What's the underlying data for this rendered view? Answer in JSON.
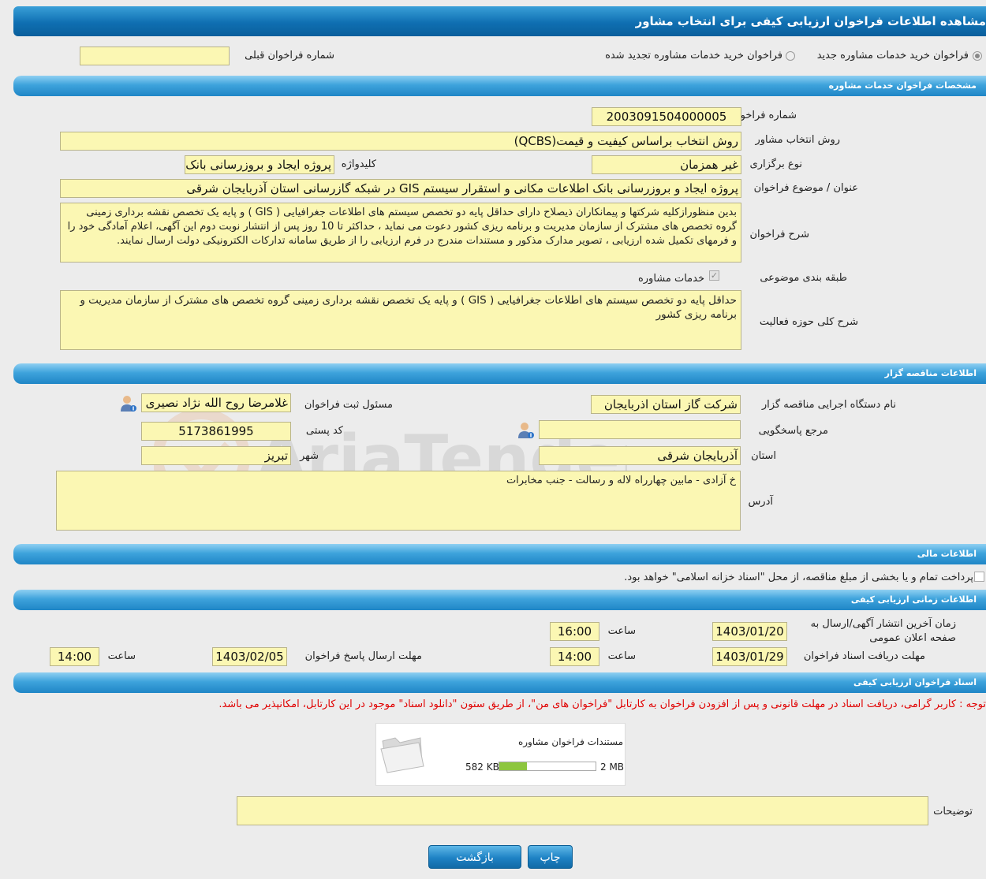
{
  "title": "مشاهده اطلاعات فراخوان ارزیابی کیفی برای انتخاب مشاور",
  "top": {
    "radio_new": "فراخوان خرید خدمات مشاوره جدید",
    "radio_renewed": "فراخوان خرید خدمات مشاوره تجدید شده",
    "prev_label": "شماره فراخوان قبلی",
    "prev_value": ""
  },
  "sec1": {
    "header": "مشخصات فراخوان خدمات مشاوره",
    "number_label": "شماره فراخوان",
    "number_value": "2003091504000005",
    "method_label": "روش انتخاب مشاور",
    "method_value": "روش انتخاب براساس کیفیت و قیمت(QCBS)",
    "type_label": "نوع برگزاری",
    "type_value": "غیر همزمان",
    "keyword_label": "کلیدواژه",
    "keyword_value": "پروژه ایجاد و بروزرسانی بانک",
    "subject_label": "عنوان / موضوع فراخوان",
    "subject_value": "پروژه ایجاد و بروزرسانی بانک اطلاعات مکانی و استقرار سیستم GIS در شبکه گازرسانی استان آذربایجان شرقی",
    "desc_label": "شرح فراخوان",
    "desc_value": "بدین منظوراز‌کلیه شرکتها و پیمانکاران ذیصلاح دارای حداقل پایه دو  تخصص سیستم های اطلاعات جغرافیایی ( GIS )  و پایه یک تخصص  نقشه برداری زمینی گروه تخصص های مشترک   از سازمان مدیریت و برنامه ریزی کشور دعوت می نماید ، حداکثر تا 10 روز پس از انتشار نوبت دوم این آگهی، اعلام آمادگی خود را و فرمهای تکمیل شده ارزیابی ، تصویر مدارک مذکور و مستندات مندرج در فرم ارزیابی را از طریق سامانه تدارکات الکترونیکی دولت ارسال نمایند.",
    "category_label": "طبقه بندی موضوعی",
    "category_value": "خدمات مشاوره",
    "scope_label": "شرح کلی حوزه فعالیت",
    "scope_value": "حداقل پایه دو  تخصص سیستم های اطلاعات جغرافیایی ( GIS )  و پایه یک تخصص  نقشه برداری زمینی گروه تخصص های مشترک   از سازمان مدیریت و برنامه ریزی کشور"
  },
  "sec2": {
    "header": "اطلاعات مناقصه گزار",
    "org_label": "نام دستگاه اجرایی مناقصه گزار",
    "org_value": "شرکت گاز استان اذربایجان",
    "resp_label": "مسئول ثبت فراخوان",
    "resp_value": "غلامرضا روح الله نژاد نصیری",
    "ref_label": "مرجع پاسخگویی",
    "ref_value": "",
    "postal_label": "کد پستی",
    "postal_value": "5173861995",
    "province_label": "استان",
    "province_value": "آذربایجان شرقی",
    "city_label": "شهر",
    "city_value": "تبریز",
    "address_label": "آدرس",
    "address_value": "خ آزادی - مابین چهارراه لاله و رسالت - جنب مخابرات"
  },
  "sec3": {
    "header": "اطلاعات مالی",
    "treasury_text": "پرداخت تمام و یا بخشی از مبلغ مناقصه، از محل \"اسناد خزانه اسلامی\" خواهد بود."
  },
  "sec4": {
    "header": "اطلاعات زمانی ارزیابی کیفی",
    "publish_label": "زمان آخرین انتشار آگهی/ارسال به صفحه اعلان عمومی",
    "publish_date": "1403/01/20",
    "time_label": "ساعت",
    "publish_time": "16:00",
    "receive_label": "مهلت دریافت اسناد فراخوان",
    "receive_date": "1403/01/29",
    "receive_time": "14:00",
    "reply_label": "مهلت ارسال پاسخ فراخوان",
    "reply_date": "1403/02/05",
    "reply_time": "14:00"
  },
  "sec5": {
    "header": "اسناد فراخوان ارزیابی کیفی",
    "notice": "توجه : کاربر گرامی، دریافت اسناد در مهلت قانونی و پس از افزودن فراخوان به کارتابل \"فراخوان های من\"، از طریق ستون \"دانلود اسناد\" موجود در این کارتابل، امکانپذیر می باشد.",
    "doc_title": "مستندات فراخوان مشاوره",
    "doc_used": "582 KB",
    "doc_total": "2 MB",
    "doc_fill": 0.29,
    "notes_label": "توضیحات",
    "notes_value": ""
  },
  "buttons": {
    "print": "چاپ",
    "back": "بازگشت"
  },
  "watermark": "AriaTender.neT",
  "colors": {
    "field_bg": "#fbf7b3",
    "header_blue": "#1f86c6",
    "notice_red": "#e00000",
    "progress_green": "#8dc63f"
  }
}
